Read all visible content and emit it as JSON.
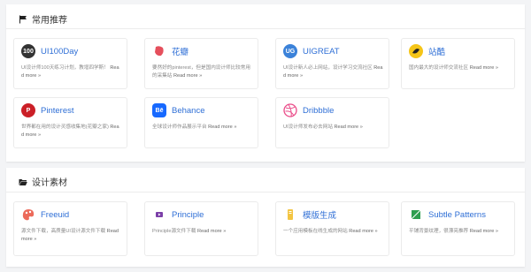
{
  "sections": [
    {
      "title": "常用推荐",
      "cards": [
        {
          "title": "UI100Day",
          "desc": "UI设计师100天练习计划，教增四学斯！",
          "more": "Read more »",
          "logo": "100",
          "color": "#333333"
        },
        {
          "title": "花瓣",
          "desc": "要然好的pinterest，但是国内设计师比较常用的采集站",
          "more": "Read more »",
          "logo": "",
          "color": "#e54f5c"
        },
        {
          "title": "UIGREAT",
          "desc": "UI设计新人必上网站，设计学习交流社区",
          "more": "Read more »",
          "logo": "UG",
          "color": "#3b82d9"
        },
        {
          "title": "站酷",
          "desc": "国内最大的设计师交流社区",
          "more": "Read more »",
          "logo": "",
          "color": "#f5c518"
        },
        {
          "title": "Pinterest",
          "desc": "世界都在用的设计灵感收集地(花瓣之家)",
          "more": "Read more »",
          "logo": "P",
          "color": "#cb1f27"
        },
        {
          "title": "Behance",
          "desc": "全球设计师作品展示平台",
          "more": "Read more »",
          "logo": "Bē",
          "color": "#1769ff"
        },
        {
          "title": "Dribbble",
          "desc": "UI设计师发布必去网站",
          "more": "Read more »",
          "logo": "",
          "color": "#ea4c89"
        }
      ]
    },
    {
      "title": "设计素材",
      "cards": [
        {
          "title": "Freeuid",
          "desc": "源文件下载，高质量UI设计源文件下载",
          "more": "Read more »",
          "logo": "",
          "color": "#ec6a5a"
        },
        {
          "title": "Principle",
          "desc": "Principle源文件下载",
          "more": "Read more »",
          "logo": "",
          "color": "#7b3fa8"
        },
        {
          "title": "模版生成",
          "desc": "一个应用模板在线生成的网站",
          "more": "Read more »",
          "logo": "",
          "color": "#f3c542"
        },
        {
          "title": "Subtle Patterns",
          "desc": "平铺背景纹理，很漂亮推荐",
          "more": "Read more »",
          "logo": "",
          "color": "#2e9e4f"
        }
      ]
    }
  ],
  "icons": {
    "section1": "flag-icon",
    "section2": "folder-open-icon"
  }
}
